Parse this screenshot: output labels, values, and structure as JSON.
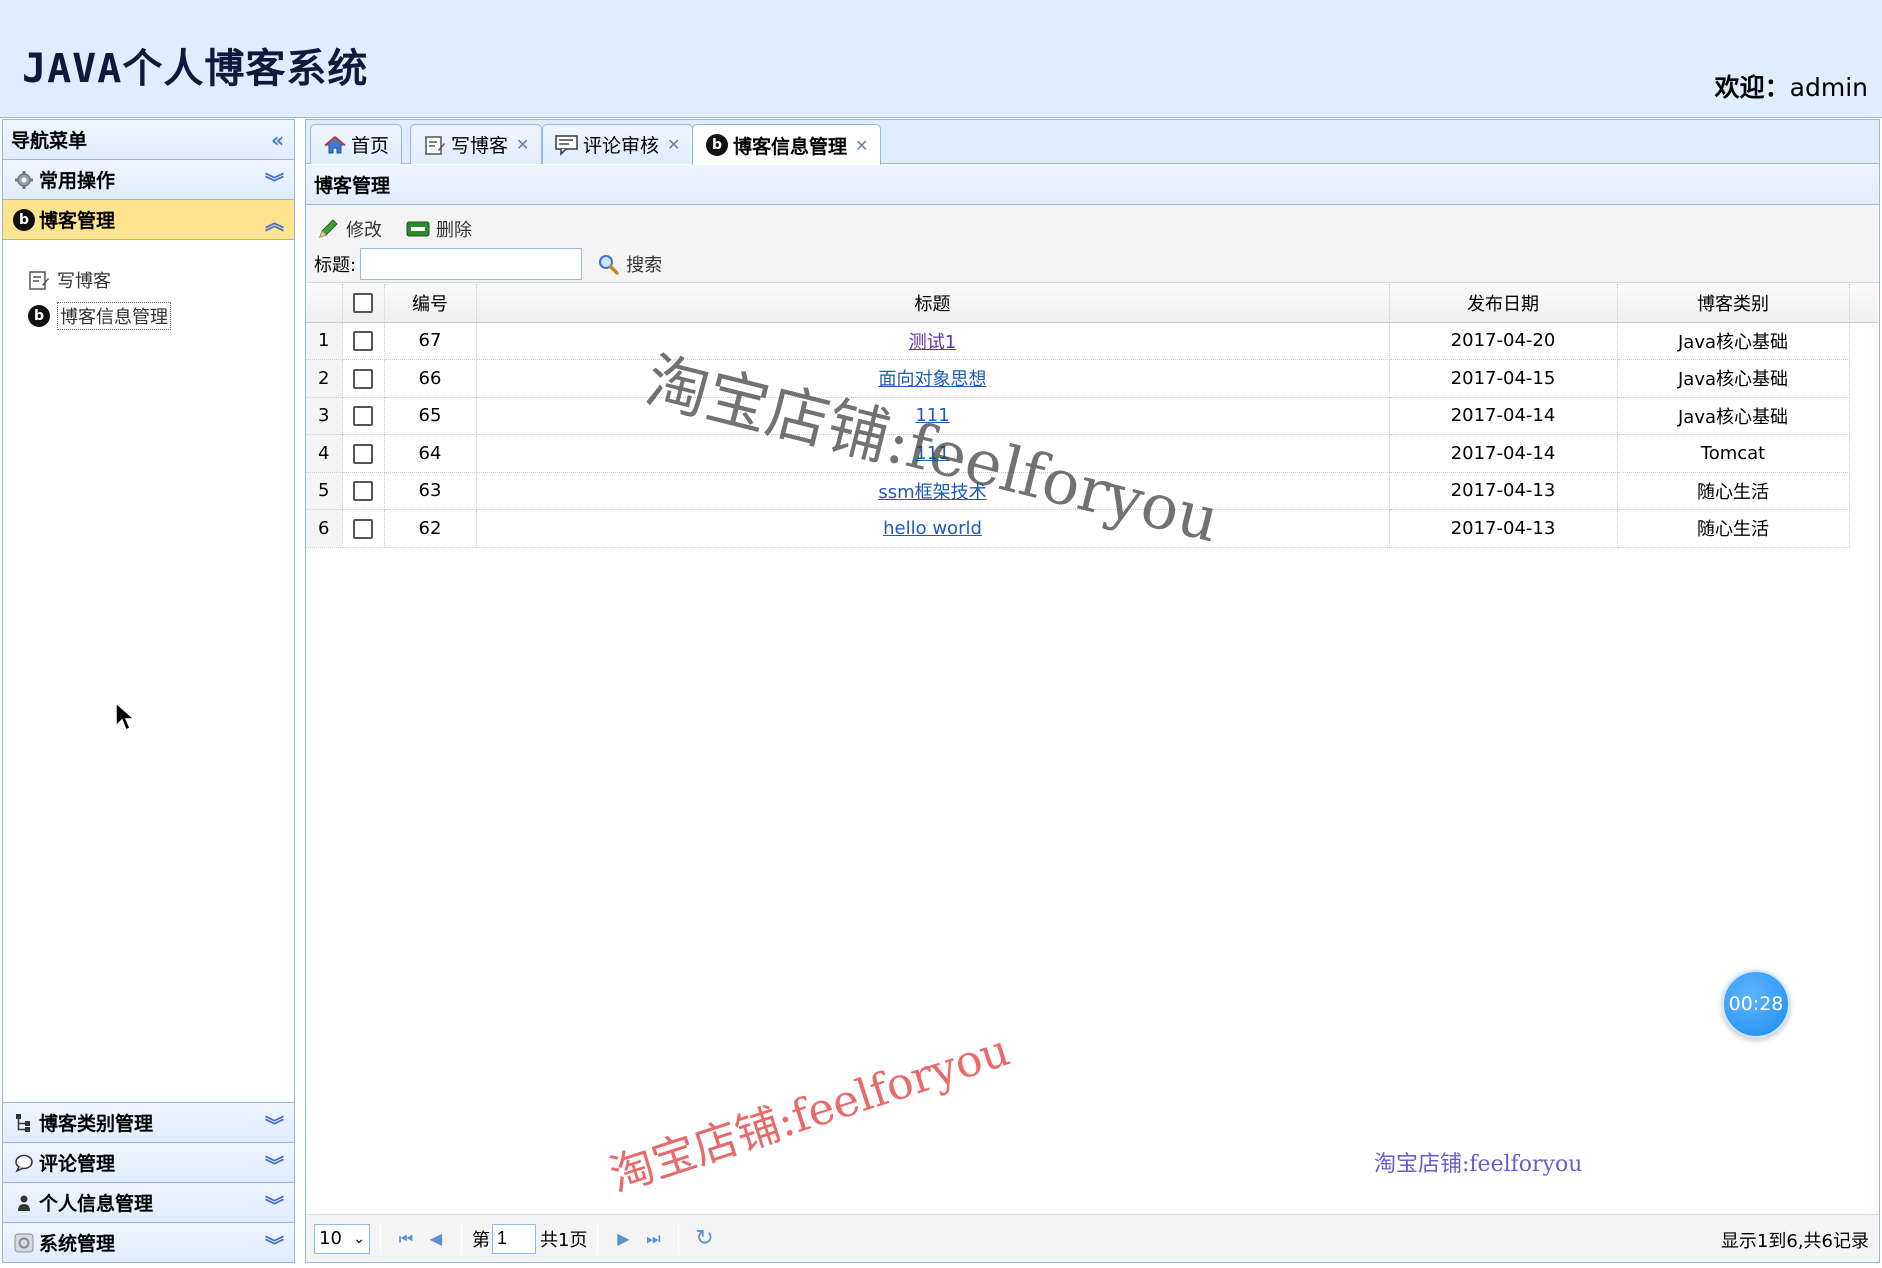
{
  "header": {
    "app_title": "JAVA个人博客系统",
    "welcome_label": "欢迎：",
    "welcome_user": "admin"
  },
  "sidebar": {
    "title": "导航菜单",
    "sections_top": [
      {
        "label": "常用操作",
        "icon": "gear-icon"
      },
      {
        "label": "博客管理",
        "icon": "blog-logo-icon",
        "active": true
      }
    ],
    "blog_menu": [
      {
        "label": "写博客",
        "icon": "edit-doc-icon"
      },
      {
        "label": "博客信息管理",
        "icon": "blog-logo-icon",
        "selected": true
      }
    ],
    "sections_bottom": [
      {
        "label": "博客类别管理",
        "icon": "tree-icon"
      },
      {
        "label": "评论管理",
        "icon": "speech-bubble-icon"
      },
      {
        "label": "个人信息管理",
        "icon": "person-icon"
      },
      {
        "label": "系统管理",
        "icon": "system-icon"
      }
    ]
  },
  "tabs": [
    {
      "label": "首页",
      "icon": "home-icon",
      "closable": false
    },
    {
      "label": "写博客",
      "icon": "edit-doc-icon",
      "closable": true
    },
    {
      "label": "评论审核",
      "icon": "comment-review-icon",
      "closable": true
    },
    {
      "label": "博客信息管理",
      "icon": "blog-logo-icon",
      "closable": true,
      "active": true
    }
  ],
  "panel": {
    "title": "博客管理",
    "edit_label": "修改",
    "delete_label": "删除",
    "search_label": "标题:",
    "search_value": "",
    "search_button": "搜索"
  },
  "grid": {
    "columns": [
      "编号",
      "标题",
      "发布日期",
      "博客类别"
    ],
    "rows": [
      {
        "rn": "1",
        "id": "67",
        "title": "测试1",
        "date": "2017-04-20",
        "category": "Java核心基础",
        "visited": true
      },
      {
        "rn": "2",
        "id": "66",
        "title": "面向对象思想",
        "date": "2017-04-15",
        "category": "Java核心基础"
      },
      {
        "rn": "3",
        "id": "65",
        "title": "111",
        "date": "2017-04-14",
        "category": "Java核心基础"
      },
      {
        "rn": "4",
        "id": "64",
        "title": "111",
        "date": "2017-04-14",
        "category": "Tomcat"
      },
      {
        "rn": "5",
        "id": "63",
        "title": "ssm框架技术",
        "date": "2017-04-13",
        "category": "随心生活"
      },
      {
        "rn": "6",
        "id": "62",
        "title": "hello world",
        "date": "2017-04-13",
        "category": "随心生活"
      }
    ]
  },
  "pager": {
    "page_size": "10",
    "page_prefix": "第",
    "page_number": "1",
    "page_total": "共1页",
    "info": "显示1到6,共6记录"
  },
  "watermark": {
    "text1": "淘宝店铺:feelforyou",
    "text2": "淘宝店铺:feelforyou",
    "text3": "淘宝店铺:feelforyou"
  },
  "timer": "00:28",
  "colors": {
    "header_bg": "#e0ecff",
    "border": "#95b8e7",
    "active_accordion": "#ffe48d",
    "link": "#1e5bb6"
  }
}
